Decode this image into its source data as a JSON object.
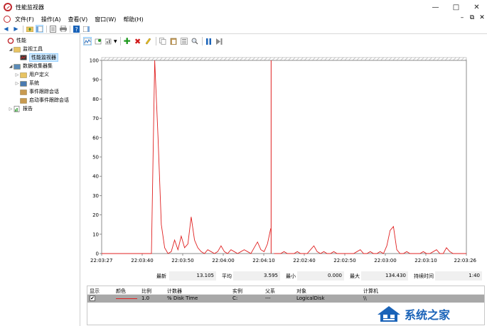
{
  "window": {
    "title": "性能监视器",
    "controls": [
      "—",
      "□",
      "✕"
    ]
  },
  "menubar": {
    "items": [
      "文件(F)",
      "操作(A)",
      "查看(V)",
      "窗口(W)",
      "帮助(H)"
    ],
    "right_controls": [
      "–",
      "⧉",
      "✕"
    ]
  },
  "tree": {
    "items": [
      {
        "label": "性能",
        "icon": "performance-icon",
        "indent": 0,
        "expander": ""
      },
      {
        "label": "监视工具",
        "icon": "folder-icon",
        "indent": 1,
        "expander": "◢"
      },
      {
        "label": "性能监视器",
        "icon": "monitor-chart-icon",
        "indent": 2,
        "expander": "",
        "selected": true
      },
      {
        "label": "数据收集器集",
        "icon": "collector-set-icon",
        "indent": 1,
        "expander": "◢"
      },
      {
        "label": "用户定义",
        "icon": "folder-icon",
        "indent": 2,
        "expander": "▷"
      },
      {
        "label": "系统",
        "icon": "system-icon",
        "indent": 2,
        "expander": "▷"
      },
      {
        "label": "事件跟踪会话",
        "icon": "event-trace-icon",
        "indent": 2,
        "expander": ""
      },
      {
        "label": "启动事件跟踪会话",
        "icon": "event-trace-icon",
        "indent": 2,
        "expander": ""
      },
      {
        "label": "报告",
        "icon": "report-icon",
        "indent": 1,
        "expander": "▷"
      }
    ]
  },
  "chart_data": {
    "type": "line",
    "title": "",
    "xlabel": "",
    "ylabel": "",
    "ylim": [
      0,
      100
    ],
    "yticks": [
      0,
      10,
      20,
      30,
      40,
      50,
      60,
      70,
      80,
      90,
      100
    ],
    "xticks": [
      "22:03:27",
      "22:03:40",
      "22:03:50",
      "22:04:00",
      "22:04:10",
      "22:02:40",
      "22:02:50",
      "22:03:00",
      "22:03:10",
      "22:03:26"
    ],
    "grid": false,
    "legend": "none",
    "current_time_marker_index": 51,
    "series": [
      {
        "counter": "% Disk Time",
        "color": "#e02020",
        "values": [
          0,
          0,
          0,
          0,
          0,
          0,
          0,
          0,
          0,
          0,
          0,
          0,
          0,
          0,
          0,
          0,
          100,
          60,
          15,
          3,
          0,
          1,
          7,
          2,
          9,
          3,
          5,
          19,
          7,
          3,
          1,
          0,
          2,
          1,
          0,
          1,
          4,
          1,
          0,
          2,
          1,
          0,
          1,
          2,
          1,
          0,
          3,
          6,
          2,
          1,
          5,
          13,
          0,
          0,
          0,
          1,
          0,
          0,
          0,
          1,
          0,
          0,
          0,
          2,
          4,
          1,
          0,
          1,
          0,
          0,
          1,
          0,
          0,
          0,
          0,
          0,
          0,
          1,
          2,
          0,
          0,
          1,
          0,
          0,
          1,
          0,
          4,
          12,
          14,
          2,
          0,
          0,
          1,
          0,
          0,
          0,
          0,
          1,
          0,
          0,
          1,
          2,
          0,
          0,
          3,
          1,
          0,
          0,
          0,
          0,
          0
        ]
      }
    ]
  },
  "stats": {
    "last_label": "最新",
    "last_value": "13.105",
    "avg_label": "平均",
    "avg_value": "3.595",
    "min_label": "最小",
    "min_value": "0.000",
    "max_label": "最大",
    "max_value": "134.430",
    "duration_label": "持续时间",
    "duration_value": "1:40"
  },
  "counters": {
    "headers": [
      "显示",
      "颜色",
      "比例",
      "计数器",
      "实例",
      "父系",
      "对象",
      "计算机"
    ],
    "rows": [
      {
        "show": "✔",
        "scale": "1.0",
        "counter": "% Disk Time",
        "instance": "C:",
        "parent": "---",
        "object": "LogicalDisk",
        "computer": "\\\\"
      }
    ]
  },
  "watermark": {
    "text": "系统之家"
  }
}
